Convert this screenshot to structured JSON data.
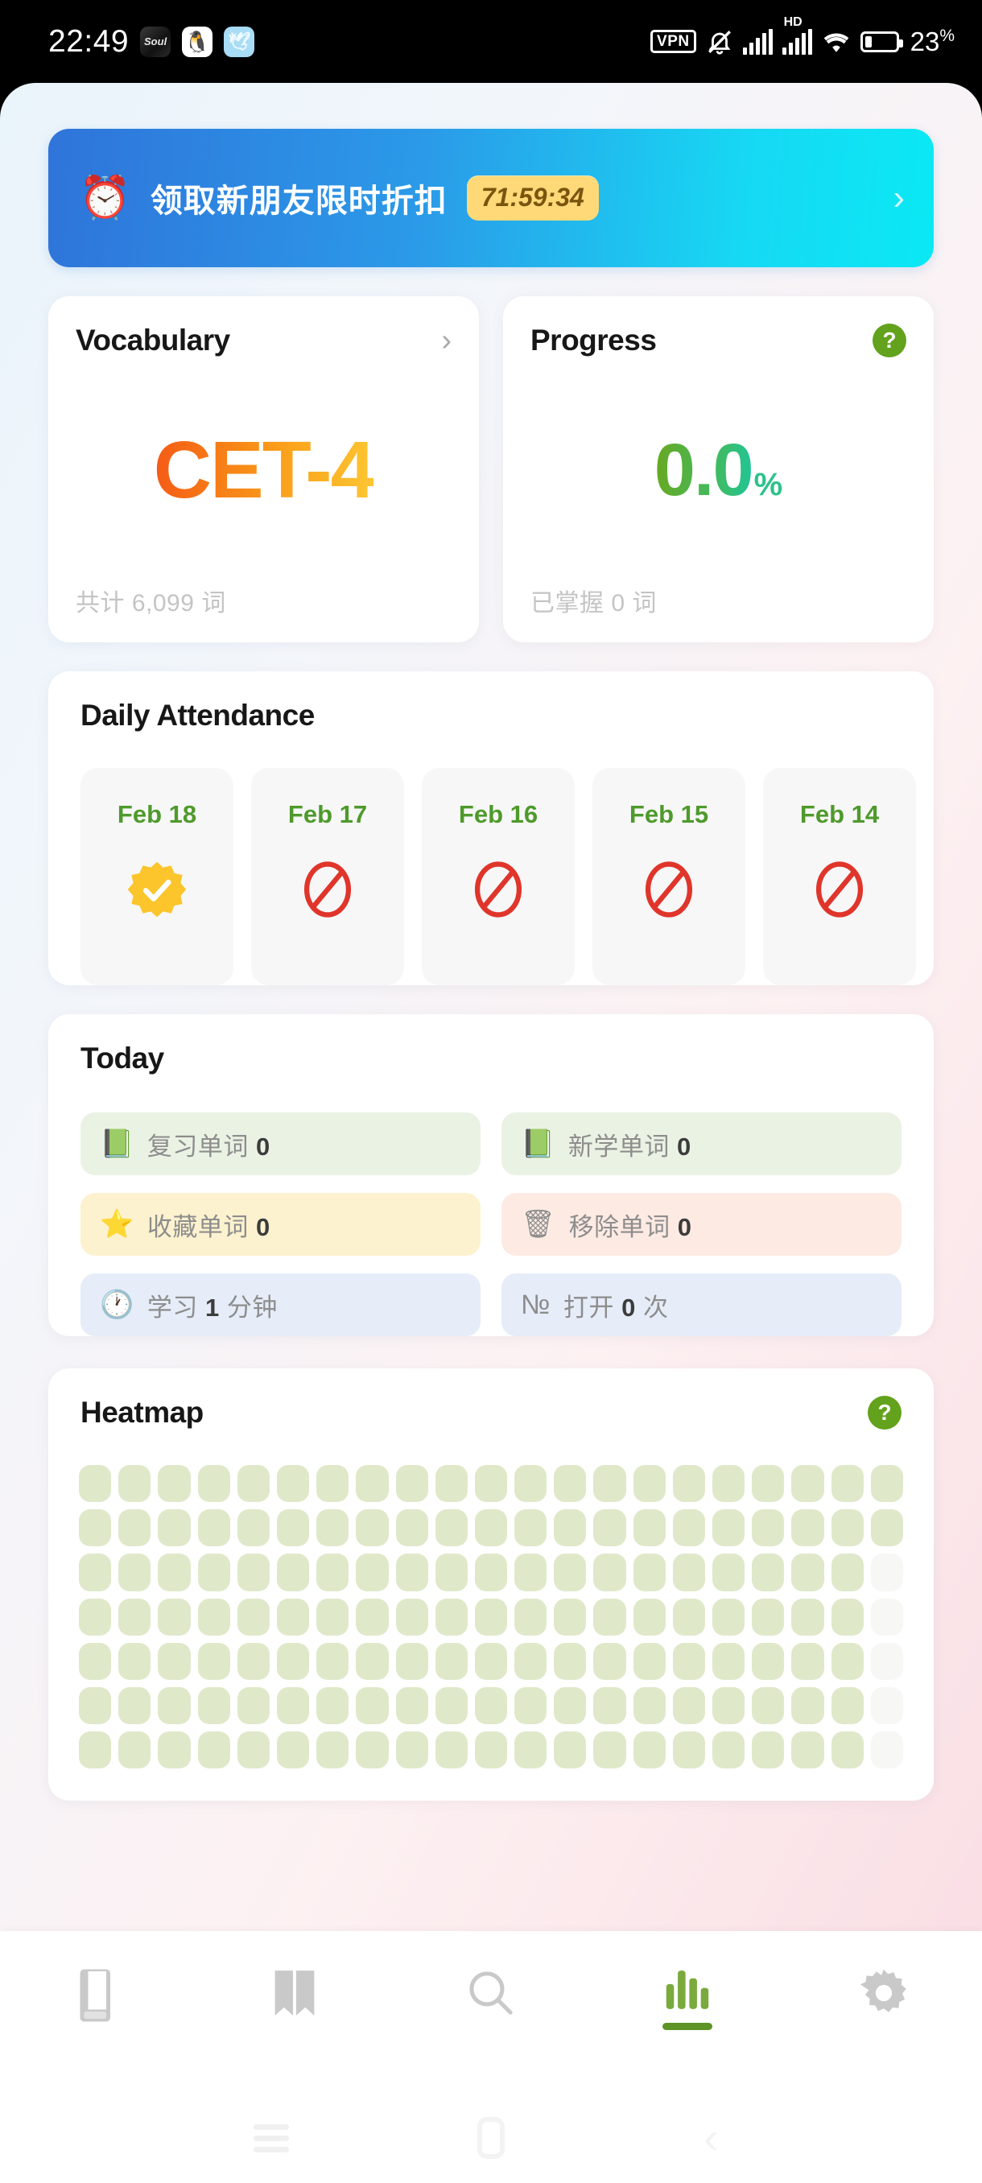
{
  "statusbar": {
    "time": "22:49",
    "notif_icons": [
      {
        "name": "soul-app-icon",
        "label": "Soul"
      },
      {
        "name": "qq-app-icon",
        "label": "🐧"
      },
      {
        "name": "bird-app-icon",
        "label": "🕊"
      }
    ],
    "vpn_label": "VPN",
    "hd_label": "HD",
    "battery_percent": "23",
    "percent_sign": "%"
  },
  "promo": {
    "icon": "⏰",
    "text": "领取新朋友限时折扣",
    "countdown": "71:59:34",
    "chevron": "›"
  },
  "vocabulary_card": {
    "title": "Vocabulary",
    "chevron": "›",
    "value": "CET-4",
    "footer": "共计 6,099 词"
  },
  "progress_card": {
    "title": "Progress",
    "help": "?",
    "value": "0.0",
    "unit": "%",
    "footer": "已掌握 0 词"
  },
  "attendance": {
    "title": "Daily Attendance",
    "days": [
      {
        "date": "Feb 18",
        "status": "checked"
      },
      {
        "date": "Feb 17",
        "status": "missed"
      },
      {
        "date": "Feb 16",
        "status": "missed"
      },
      {
        "date": "Feb 15",
        "status": "missed"
      },
      {
        "date": "Feb 14",
        "status": "missed"
      }
    ]
  },
  "today": {
    "title": "Today",
    "items": [
      {
        "icon": "📗",
        "icon_name": "green-book-icon",
        "label": "复习单词",
        "value": "0",
        "tone": "green"
      },
      {
        "icon": "📗",
        "icon_name": "green-book-icon",
        "label": "新学单词",
        "value": "0",
        "tone": "green"
      },
      {
        "icon": "⭐",
        "icon_name": "star-icon",
        "label": "收藏单词",
        "value": "0",
        "tone": "yellow"
      },
      {
        "icon": "🗑",
        "icon_name": "trash-slash-icon",
        "label": "移除单词",
        "value": "0",
        "tone": "pink"
      },
      {
        "icon": "🕐",
        "icon_name": "clock-icon",
        "label": "学习",
        "value": "1",
        "suffix": "分钟",
        "tone": "blue"
      },
      {
        "icon": "№",
        "icon_name": "numero-icon",
        "label": "打开",
        "value": "0",
        "suffix": "次",
        "tone": "blue"
      }
    ]
  },
  "heatmap": {
    "title": "Heatmap",
    "help": "?",
    "columns": 21,
    "rows": 7,
    "empty_cells": [
      "2,20",
      "3,20",
      "4,20",
      "5,20",
      "6,20"
    ]
  },
  "tabbar": {
    "items": [
      {
        "name": "tab-book",
        "icon": "closed-book-icon",
        "active": false
      },
      {
        "name": "tab-reading",
        "icon": "open-book-icon",
        "active": false
      },
      {
        "name": "tab-search",
        "icon": "search-icon",
        "active": false
      },
      {
        "name": "tab-stats",
        "icon": "bar-chart-icon",
        "active": true
      },
      {
        "name": "tab-settings",
        "icon": "gear-icon",
        "active": false
      }
    ]
  },
  "androidnav": {
    "recents": "recents-icon",
    "home": "home-icon",
    "back": "back-icon"
  },
  "colors": {
    "accent_green": "#63a21c",
    "tab_active": "#5d9425",
    "promo_start": "#2f74da",
    "promo_end": "#0ae9f4",
    "countdown_bg": "#ffd977",
    "heat_cell": "#dfe9ca"
  }
}
